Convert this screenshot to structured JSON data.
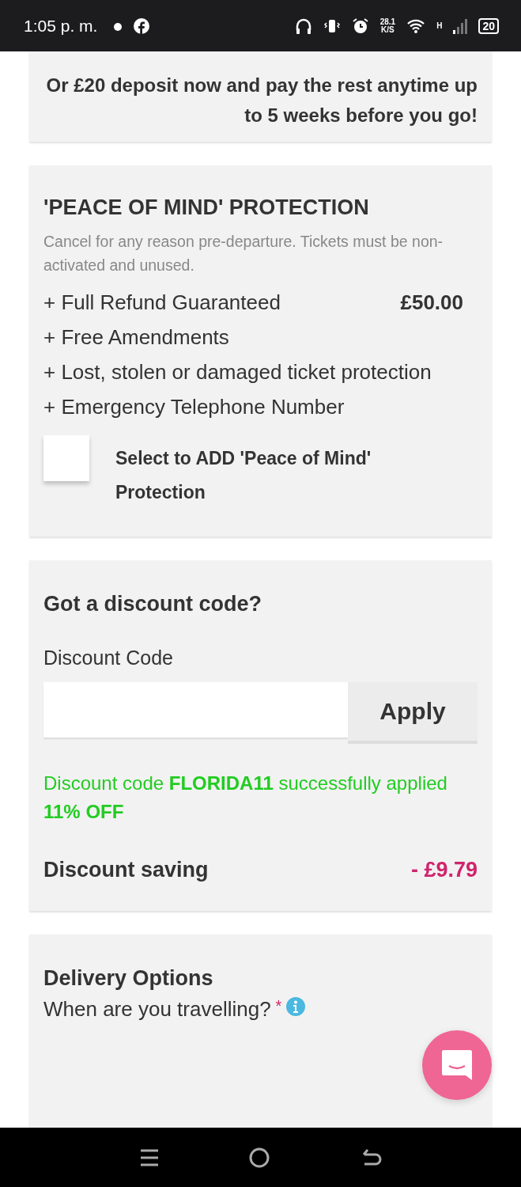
{
  "status_bar": {
    "time": "1:05 p. m.",
    "speed": "28.1",
    "speed_unit": "K/S",
    "network": "H",
    "battery": "20"
  },
  "summary": {
    "deposit_note": "Or £20 deposit now and pay the rest anytime up to 5 weeks before you go!"
  },
  "protection": {
    "title": "'PEACE OF MIND' PROTECTION",
    "note": "Cancel for any reason pre-departure. Tickets must be non-activated and unused.",
    "price": "£50.00",
    "benefits": [
      "+ Full Refund Guaranteed",
      "+ Free Amendments",
      "+ Lost, stolen or damaged ticket protection",
      "+ Emergency Telephone Number"
    ],
    "checkbox": {
      "label": "Select to ADD 'Peace of Mind' Protection",
      "checked": false
    }
  },
  "discount": {
    "title": "Got a discount code?",
    "field_label": "Discount Code",
    "apply_button": "Apply",
    "message": "Discount code **FLORIDA11** successfully applied",
    "offer": "11% OFF",
    "saving_label": "Discount saving",
    "saving_value": "- £9.79"
  },
  "delivery": {
    "title": "Delivery Options",
    "question": "When are you travelling?",
    "required_mark": "*"
  }
}
